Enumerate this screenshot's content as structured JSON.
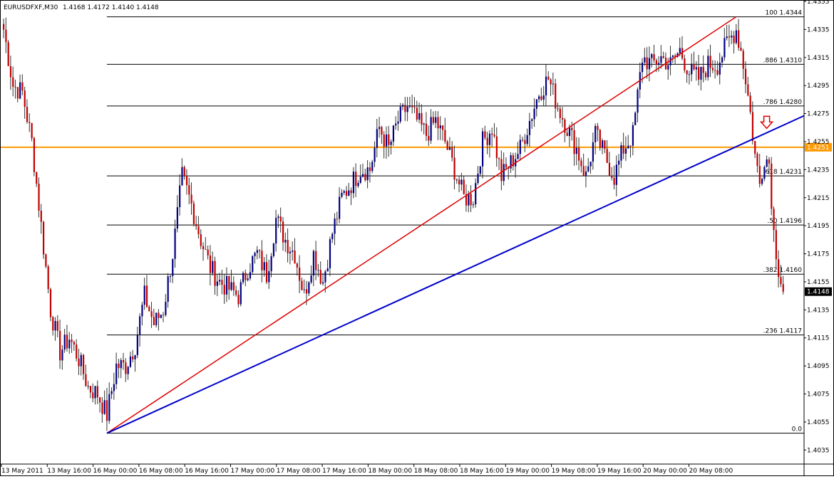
{
  "symbol_header": {
    "symbol": "EURUSDFXF,M30",
    "ohlc": "1.4168 1.4172 1.4140 1.4148"
  },
  "colors": {
    "background": "#ffffff",
    "grid_text": "#000000",
    "fib_lines": "#000000",
    "orange_level": "#ff9900",
    "red_trendline": "#e00000",
    "blue_trendline": "#0000cc",
    "candle_bear": "#c00000",
    "candle_bull": "#000080",
    "arrow": "#e00000"
  },
  "chart_data": {
    "type": "candlestick",
    "title": "EURUSDFXF,M30",
    "ylim": [
      1.4025,
      1.4355
    ],
    "y_ticks": [
      "1.4355",
      "1.4335",
      "1.4315",
      "1.4295",
      "1.4275",
      "1.4255",
      "1.4235",
      "1.4215",
      "1.4195",
      "1.4175",
      "1.4155",
      "1.4135",
      "1.4115",
      "1.4095",
      "1.4075",
      "1.4055",
      "1.4035"
    ],
    "x_ticks": [
      "13 May 2011",
      "13 May 16:00",
      "16 May 00:00",
      "16 May 08:00",
      "16 May 16:00",
      "17 May 00:00",
      "17 May 08:00",
      "17 May 16:00",
      "18 May 00:00",
      "18 May 08:00",
      "18 May 16:00",
      "19 May 00:00",
      "19 May 08:00",
      "19 May 16:00",
      "20 May 00:00",
      "20 May 08:00"
    ],
    "price_path": [
      {
        "bar": 0,
        "price": 1.4335
      },
      {
        "bar": 4,
        "price": 1.4295
      },
      {
        "bar": 8,
        "price": 1.429
      },
      {
        "bar": 12,
        "price": 1.4255
      },
      {
        "bar": 16,
        "price": 1.4195
      },
      {
        "bar": 20,
        "price": 1.4135
      },
      {
        "bar": 24,
        "price": 1.4105
      },
      {
        "bar": 28,
        "price": 1.4115
      },
      {
        "bar": 32,
        "price": 1.41
      },
      {
        "bar": 36,
        "price": 1.408
      },
      {
        "bar": 40,
        "price": 1.4075
      },
      {
        "bar": 44,
        "price": 1.406
      },
      {
        "bar": 48,
        "price": 1.4095
      },
      {
        "bar": 52,
        "price": 1.4095
      },
      {
        "bar": 56,
        "price": 1.411
      },
      {
        "bar": 60,
        "price": 1.4145
      },
      {
        "bar": 64,
        "price": 1.4125
      },
      {
        "bar": 68,
        "price": 1.4135
      },
      {
        "bar": 72,
        "price": 1.4175
      },
      {
        "bar": 76,
        "price": 1.423
      },
      {
        "bar": 80,
        "price": 1.421
      },
      {
        "bar": 84,
        "price": 1.4185
      },
      {
        "bar": 88,
        "price": 1.4165
      },
      {
        "bar": 92,
        "price": 1.4155
      },
      {
        "bar": 96,
        "price": 1.415
      },
      {
        "bar": 100,
        "price": 1.4145
      },
      {
        "bar": 104,
        "price": 1.4165
      },
      {
        "bar": 108,
        "price": 1.4175
      },
      {
        "bar": 112,
        "price": 1.416
      },
      {
        "bar": 116,
        "price": 1.42
      },
      {
        "bar": 120,
        "price": 1.4185
      },
      {
        "bar": 124,
        "price": 1.4175
      },
      {
        "bar": 128,
        "price": 1.4145
      },
      {
        "bar": 132,
        "price": 1.4175
      },
      {
        "bar": 136,
        "price": 1.4155
      },
      {
        "bar": 140,
        "price": 1.419
      },
      {
        "bar": 144,
        "price": 1.4215
      },
      {
        "bar": 148,
        "price": 1.4225
      },
      {
        "bar": 152,
        "price": 1.4235
      },
      {
        "bar": 156,
        "price": 1.4235
      },
      {
        "bar": 160,
        "price": 1.4265
      },
      {
        "bar": 164,
        "price": 1.425
      },
      {
        "bar": 168,
        "price": 1.427
      },
      {
        "bar": 172,
        "price": 1.428
      },
      {
        "bar": 176,
        "price": 1.427
      },
      {
        "bar": 180,
        "price": 1.426
      },
      {
        "bar": 184,
        "price": 1.427
      },
      {
        "bar": 188,
        "price": 1.4255
      },
      {
        "bar": 192,
        "price": 1.4235
      },
      {
        "bar": 196,
        "price": 1.4215
      },
      {
        "bar": 200,
        "price": 1.4215
      },
      {
        "bar": 204,
        "price": 1.4255
      },
      {
        "bar": 208,
        "price": 1.4265
      },
      {
        "bar": 212,
        "price": 1.423
      },
      {
        "bar": 216,
        "price": 1.424
      },
      {
        "bar": 220,
        "price": 1.425
      },
      {
        "bar": 224,
        "price": 1.427
      },
      {
        "bar": 228,
        "price": 1.429
      },
      {
        "bar": 232,
        "price": 1.43
      },
      {
        "bar": 236,
        "price": 1.428
      },
      {
        "bar": 240,
        "price": 1.4265
      },
      {
        "bar": 244,
        "price": 1.425
      },
      {
        "bar": 248,
        "price": 1.423
      },
      {
        "bar": 252,
        "price": 1.426
      },
      {
        "bar": 256,
        "price": 1.4245
      },
      {
        "bar": 260,
        "price": 1.423
      },
      {
        "bar": 264,
        "price": 1.425
      },
      {
        "bar": 268,
        "price": 1.426
      },
      {
        "bar": 272,
        "price": 1.4315
      },
      {
        "bar": 276,
        "price": 1.431
      },
      {
        "bar": 280,
        "price": 1.4315
      },
      {
        "bar": 284,
        "price": 1.431
      },
      {
        "bar": 288,
        "price": 1.432
      },
      {
        "bar": 292,
        "price": 1.4305
      },
      {
        "bar": 296,
        "price": 1.43
      },
      {
        "bar": 300,
        "price": 1.431
      },
      {
        "bar": 304,
        "price": 1.431
      },
      {
        "bar": 308,
        "price": 1.4325
      },
      {
        "bar": 312,
        "price": 1.4335
      },
      {
        "bar": 314,
        "price": 1.432
      },
      {
        "bar": 316,
        "price": 1.43
      },
      {
        "bar": 318,
        "price": 1.4275
      },
      {
        "bar": 320,
        "price": 1.4245
      },
      {
        "bar": 322,
        "price": 1.4225
      },
      {
        "bar": 324,
        "price": 1.4245
      },
      {
        "bar": 326,
        "price": 1.424
      },
      {
        "bar": 328,
        "price": 1.419
      },
      {
        "bar": 330,
        "price": 1.4165
      },
      {
        "bar": 332,
        "price": 1.4148
      }
    ],
    "fib_levels": [
      {
        "label": "100",
        "value": "1.4344"
      },
      {
        "label": ".886",
        "value": "1.4310"
      },
      {
        "label": ".786",
        "value": "1.4280"
      },
      {
        "label": ".618",
        "value": "1.4231"
      },
      {
        "label": ".50",
        "value": "1.4196"
      },
      {
        "label": ".382",
        "value": "1.4160"
      },
      {
        "label": ".236",
        "value": "1.4117"
      },
      {
        "label": "0.0",
        "value": ""
      }
    ],
    "fib_low": 1.4047,
    "fib_high": 1.4344,
    "fib_start_bar": 44,
    "total_bars": 340,
    "horizontal_level": "1.4251",
    "current_price": "1.4148",
    "red_trendline": {
      "from": {
        "bar": 44,
        "price": 1.4047
      },
      "to": {
        "bar": 312,
        "price": 1.4344
      }
    },
    "blue_trendline": {
      "from": {
        "bar": 44,
        "price": 1.4047
      },
      "to": {
        "bar": 360,
        "price": 1.4288
      }
    },
    "arrow_marker": {
      "bar": 325,
      "price": 1.4268,
      "direction": "down"
    }
  }
}
